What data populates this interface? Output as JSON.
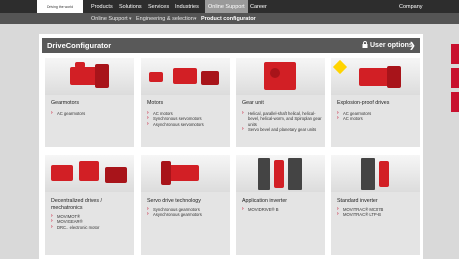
{
  "header": {
    "logo_text": "Driving the world",
    "nav": [
      "Products",
      "Solutions",
      "Services",
      "Industries",
      "Online Support",
      "Career"
    ],
    "company_label": "Company"
  },
  "breadcrumb": {
    "items": [
      "Online Support",
      "Engineering & selection",
      "Product configurator"
    ]
  },
  "configurator": {
    "title": "DriveConfigurator",
    "user_options_label": "User options"
  },
  "colors": {
    "brand": "#c8102e",
    "header_dark": "#2d2d2d",
    "panel_header": "#595959"
  },
  "cards": [
    {
      "title": "Gearmotors",
      "items": [
        "AC gearmotors"
      ]
    },
    {
      "title": "Motors",
      "items": [
        "AC motors",
        "Synchronous servomotors",
        "Asynchronous servomotors"
      ]
    },
    {
      "title": "Gear unit",
      "items": [
        "Helical, parallel-shaft helical, helical-bevel, helical-worm, and Spiroplan gear units",
        "Servo bevel and planetary gear units"
      ]
    },
    {
      "title": "Explosion-proof drives",
      "items": [
        "AC gearmotors",
        "AC motors"
      ]
    },
    {
      "title": "Decentralized drives / mechatronics",
      "items": [
        "MOVIMOT®",
        "MOVIGEAR®",
        "DRC.. electronic motor"
      ]
    },
    {
      "title": "Servo drive technology",
      "items": [
        "Synchronous gearmotors",
        "Asynchronous gearmotors"
      ]
    },
    {
      "title": "Application inverter",
      "items": [
        "MOVIDRIVE® B"
      ]
    },
    {
      "title": "Standard inverter",
      "items": [
        "MOVITRAC® MC07B",
        "MOVITRAC® LTP-B"
      ]
    }
  ]
}
